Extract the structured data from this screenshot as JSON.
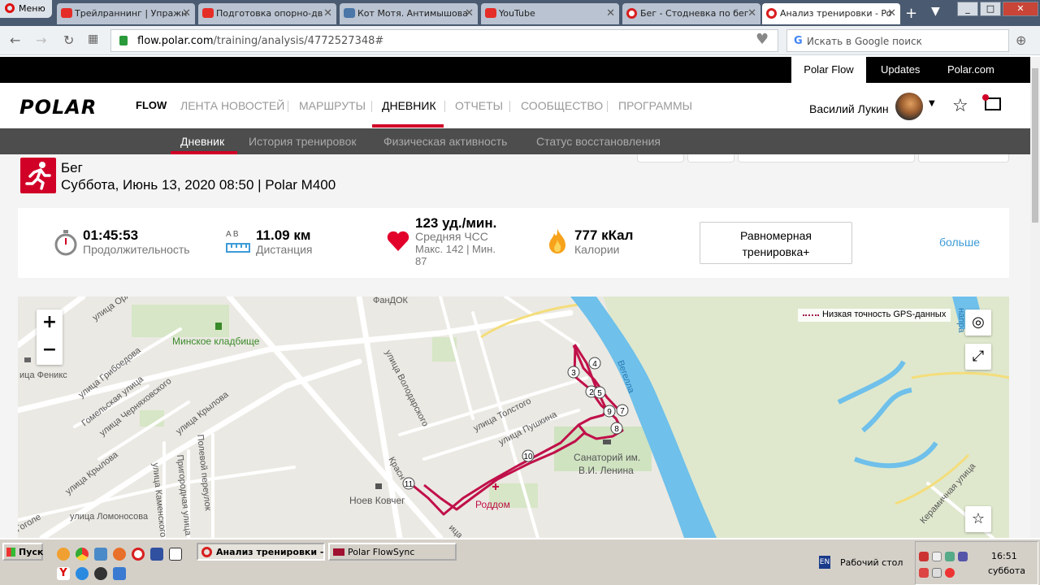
{
  "browser": {
    "menu_label": "Меню",
    "tabs": [
      {
        "label": "Трейлраннинг | Упражн"
      },
      {
        "label": "Подготовка опорно-дв"
      },
      {
        "label": "Кот Мотя. Антимышова"
      },
      {
        "label": "YouTube"
      },
      {
        "label": "Бег - Стодневка по бег"
      },
      {
        "label": "Анализ тренировки - Po"
      }
    ],
    "url_domain": "flow.polar.com",
    "url_path": "/training/analysis/4772527348#",
    "search_placeholder": "Искать в Google поиск"
  },
  "polar_top": {
    "flow": "Polar Flow",
    "updates": "Updates",
    "polarcom": "Polar.com"
  },
  "header": {
    "logo": "POLAR",
    "flow": "FLOW",
    "nav": [
      "ЛЕНТА НОВОСТЕЙ",
      "МАРШРУТЫ",
      "ДНЕВНИК",
      "ОТЧЕТЫ",
      "СООБЩЕСТВО",
      "ПРОГРАММЫ"
    ],
    "user_name": "Василий Лукин"
  },
  "subnav": [
    "Дневник",
    "История тренировок",
    "Физическая активность",
    "Статус восстановления"
  ],
  "training": {
    "sport": "Бег",
    "date": "Суббота, Июнь 13, 2020 08:50 | Polar M400"
  },
  "summary": {
    "duration": "01:45:53",
    "duration_label": "Продолжительность",
    "distance_ab": "A  B",
    "distance": "11.09 км",
    "distance_label": "Дистанция",
    "hr": "123 уд./мин.",
    "hr_label": "Средняя ЧСС",
    "hr_max": "Макс. 142  |  Мин.",
    "hr_min": "87",
    "calories": "777 кКал",
    "calories_label": "Калории",
    "benefit_1": "Равномерная",
    "benefit_2": "тренировка+",
    "more": "больше"
  },
  "map": {
    "gps_legend": "Низкая точность GPS-данных",
    "labels": [
      "улица Орл",
      "ФанДОК",
      "Минское кладбище",
      "улица Грибоедова",
      "Гомельская улица",
      "улица Черняховского",
      "улица Крылова",
      "улица Крылова",
      "улица Володарского",
      "улица Толстого",
      "улица Пушкина",
      "Санаторий им.",
      "В.И. Ленина",
      "Ноев Ковчег",
      "Роддом",
      "Полевой переулок",
      "Пригородная улица",
      "улица Каменского",
      "улица Ломоносова",
      "Керамичная улица",
      "Вегелла",
      "ица Феникс",
      "Красн",
      "ица",
      "Гоголе",
      "напра"
    ],
    "markers": [
      "2",
      "3",
      "4",
      "5",
      "7",
      "8",
      "9",
      "10",
      "11"
    ]
  },
  "taskbar": {
    "start": "Пуск",
    "tasks": [
      "Анализ тренировки - ...",
      "Polar FlowSync"
    ],
    "lang": "EN",
    "desktop": "Рабочий стол",
    "time": "16:51",
    "day": "суббота"
  }
}
